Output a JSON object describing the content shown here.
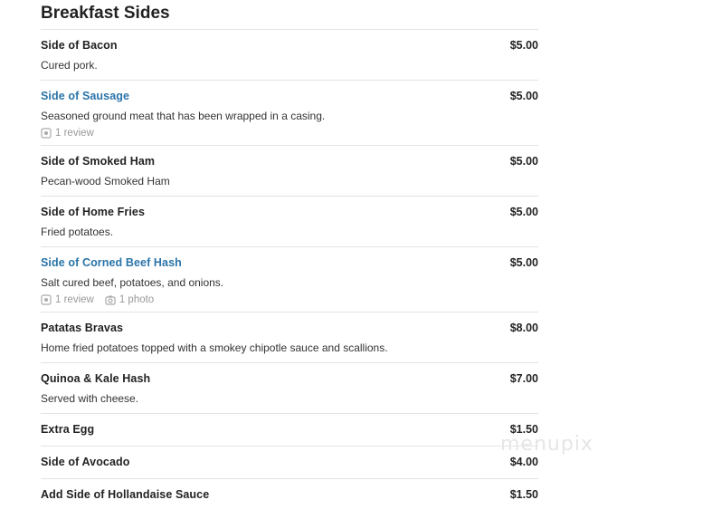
{
  "section": {
    "title": "Breakfast Sides"
  },
  "items": [
    {
      "name": "Side of Bacon",
      "price": "$5.00",
      "desc": "Cured pork."
    },
    {
      "name": "Side of Sausage",
      "price": "$5.00",
      "desc": "Seasoned ground meat that has been wrapped in a casing.",
      "review": "1 review"
    },
    {
      "name": "Side of Smoked Ham",
      "price": "$5.00",
      "desc": "Pecan-wood Smoked Ham"
    },
    {
      "name": "Side of Home Fries",
      "price": "$5.00",
      "desc": "Fried potatoes."
    },
    {
      "name": "Side of Corned Beef Hash",
      "price": "$5.00",
      "desc": "Salt cured beef, potatoes, and onions.",
      "review": "1 review",
      "photo": "1 photo"
    },
    {
      "name": "Patatas Bravas",
      "price": "$8.00",
      "desc": "Home fried potatoes topped with a smokey chipotle sauce and scallions."
    },
    {
      "name": "Quinoa & Kale Hash",
      "price": "$7.00",
      "desc": "Served with cheese."
    },
    {
      "name": "Extra Egg",
      "price": "$1.50"
    },
    {
      "name": "Side of Avocado",
      "price": "$4.00"
    },
    {
      "name": "Add Side of Hollandaise Sauce",
      "price": "$1.50"
    }
  ],
  "watermark": "menupix",
  "icons": {
    "review": "review-icon",
    "photo": "camera-icon"
  },
  "colors": {
    "link": "#2a74a8",
    "text": "#222222",
    "muted": "#999999"
  }
}
